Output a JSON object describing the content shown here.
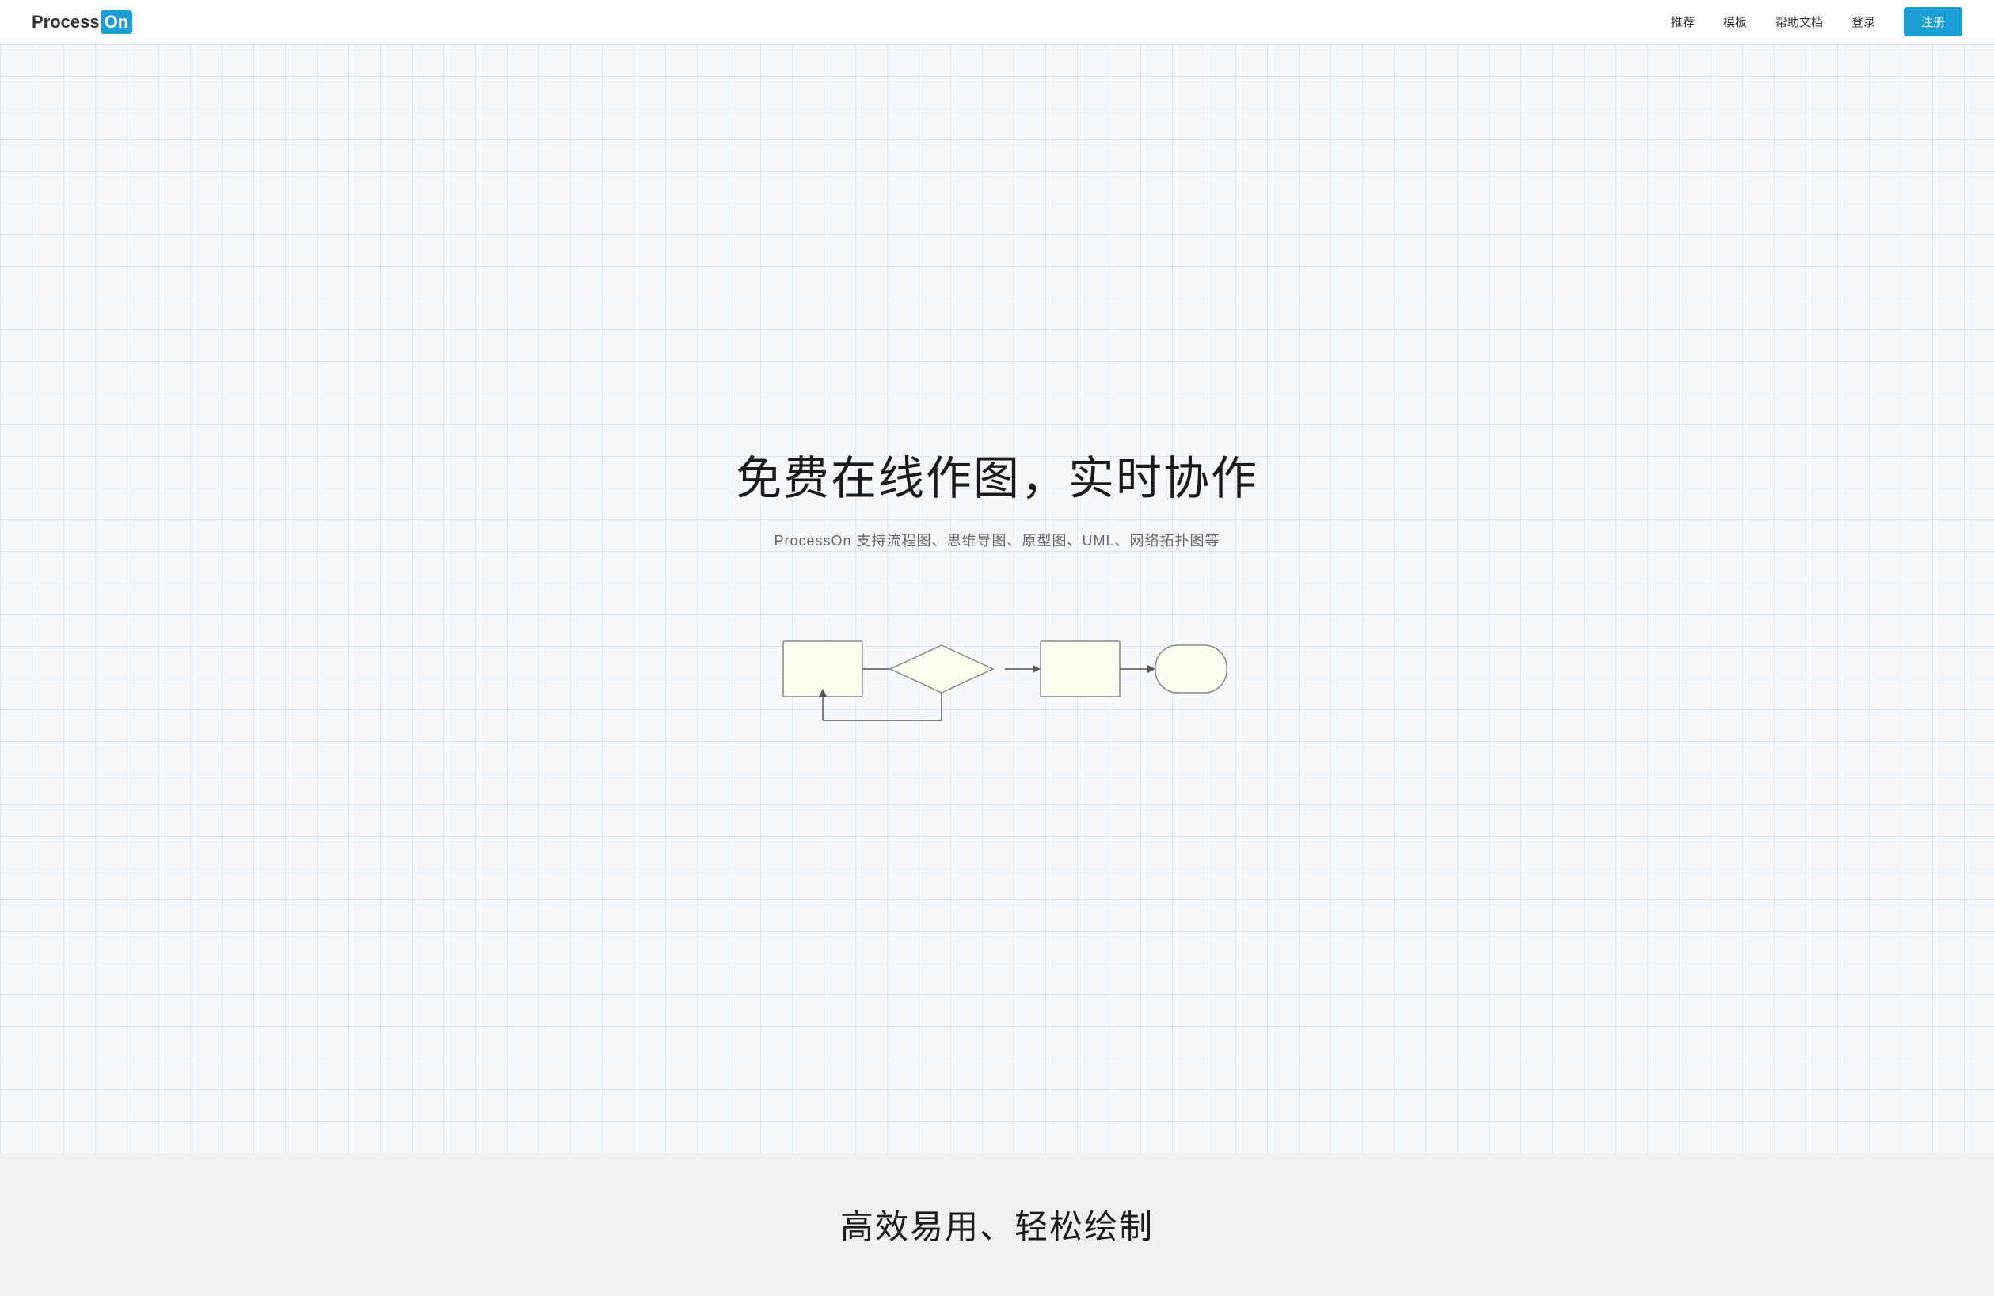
{
  "navbar": {
    "logo_process": "Process",
    "logo_on": "On",
    "nav_items": [
      {
        "label": "推荐",
        "id": "recommend"
      },
      {
        "label": "模板",
        "id": "templates"
      },
      {
        "label": "帮助文档",
        "id": "help"
      },
      {
        "label": "登录",
        "id": "login"
      }
    ],
    "register_label": "注册"
  },
  "hero": {
    "title": "免费在线作图，实时协作",
    "subtitle": "ProcessOn 支持流程图、思维导图、原型图、UML、网络拓扑图等"
  },
  "bottom": {
    "title": "高效易用、轻松绘制"
  }
}
